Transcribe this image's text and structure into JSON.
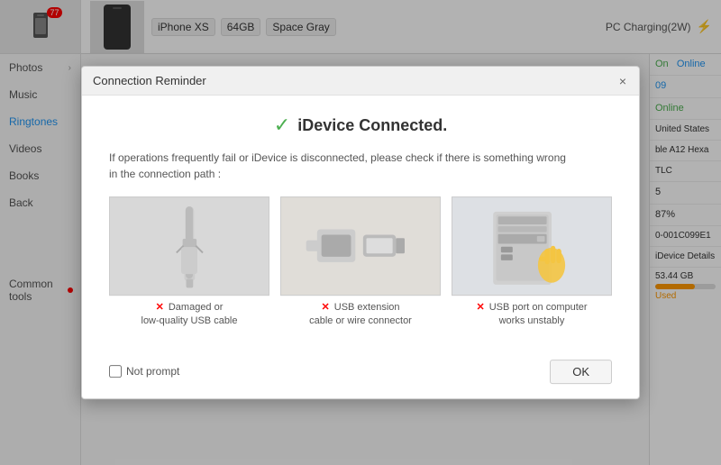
{
  "sidebar": {
    "badge": "77",
    "items": [
      {
        "id": "photos",
        "label": "Photos",
        "chevron": true,
        "dot": false
      },
      {
        "id": "music",
        "label": "Music",
        "chevron": false,
        "dot": false
      },
      {
        "id": "ringtones",
        "label": "Ringtones",
        "chevron": false,
        "dot": false,
        "active": true
      },
      {
        "id": "videos",
        "label": "Videos",
        "chevron": false,
        "dot": false
      },
      {
        "id": "books",
        "label": "Books",
        "chevron": false,
        "dot": false
      },
      {
        "id": "back",
        "label": "Back",
        "chevron": false,
        "dot": false
      },
      {
        "id": "common-tools",
        "label": "Common tools",
        "chevron": false,
        "dot": true
      }
    ]
  },
  "header": {
    "device_name": "iPhone XS",
    "storage": "64GB",
    "color": "Space Gray",
    "charging": "PC Charging(2W)"
  },
  "right_panel": {
    "on_label": "On",
    "online_label": "Online",
    "os_value": "09",
    "status_value": "Online",
    "region": "United States",
    "chip": "ble A12 Hexa",
    "tlc": "TLC",
    "num": "5",
    "battery": "87%",
    "uuid": "0-001C099E1",
    "device_details": "iDevice Details",
    "storage_size": "53.44 GB",
    "used_label": "Used"
  },
  "modal": {
    "title": "Connection Reminder",
    "close_label": "×",
    "connected_text": "iDevice Connected.",
    "description": "If operations frequently fail or iDevice is disconnected, please check if there is something wrong\nin the connection path :",
    "images": [
      {
        "id": "cable",
        "x_label": "×",
        "label_line1": "Damaged or",
        "label_line2": "low-quality USB cable"
      },
      {
        "id": "usb-connector",
        "x_label": "×",
        "label_line1": "USB extension",
        "label_line2": "cable or wire connector"
      },
      {
        "id": "computer",
        "x_label": "×",
        "label_line1": "USB port on computer",
        "label_line2": "works unstably"
      }
    ],
    "checkbox_label": "Not prompt",
    "ok_label": "OK"
  }
}
